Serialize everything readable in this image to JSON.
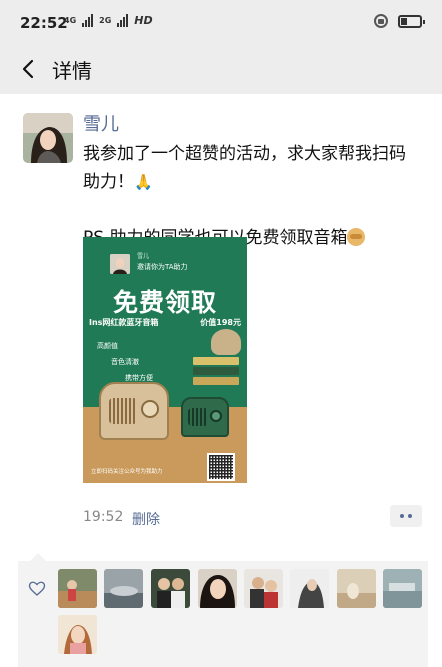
{
  "status_bar": {
    "time": "22:52",
    "network_1": "4G",
    "network_2": "2G",
    "hd": "HD"
  },
  "nav": {
    "title": "详情"
  },
  "post": {
    "username": "雪儿",
    "text_line1": "我参加了一个超赞的活动，求大家帮我扫码助力！",
    "text_line2": "PS.助力的同学也可以免费领取音箱",
    "time": "19:52",
    "delete_label": "删除"
  },
  "poster": {
    "name": "雪儿",
    "invite": "邀请你为TA助力",
    "title": "免费领取",
    "subtitle": "Ins网红款蓝牙音箱",
    "price": "价值198元",
    "features": [
      "高颜值",
      "音色清澈",
      "携带方便"
    ],
    "footer": "立即扫码关注公众号为我助力"
  },
  "likes": {
    "count_rows": 2,
    "avatars": [
      "avatar-1",
      "avatar-2",
      "avatar-3",
      "avatar-4",
      "avatar-5",
      "avatar-6",
      "avatar-7",
      "avatar-8",
      "avatar-9"
    ]
  },
  "colors": {
    "link": "#576b95",
    "bar_bg": "#ededed",
    "poster_green": "#1f7a55"
  }
}
